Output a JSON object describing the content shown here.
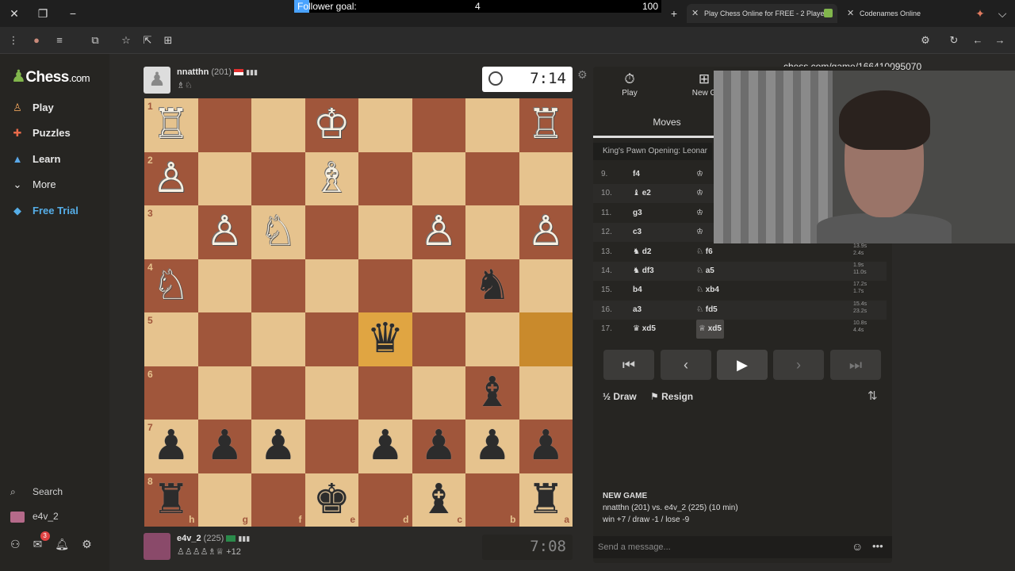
{
  "browser": {
    "follower_goal": {
      "label": "Follower goal:",
      "current": "4",
      "target": "100",
      "progress": 0.04
    },
    "tabs": [
      {
        "title": "Play Chess Online for FREE - 2 Player",
        "active": true
      },
      {
        "title": "Codenames Online",
        "active": false
      }
    ],
    "url": "chess.com/game/166410095070"
  },
  "sidebar": {
    "logo_text": "Chess",
    "logo_suffix": ".com",
    "nav": [
      {
        "label": "Play",
        "icon": "play-hand-icon"
      },
      {
        "label": "Puzzles",
        "icon": "puzzle-icon"
      },
      {
        "label": "Learn",
        "icon": "learn-cap-icon"
      },
      {
        "label": "More",
        "icon": "chevron-down-icon"
      },
      {
        "label": "Free Trial",
        "icon": "diamond-icon"
      }
    ],
    "search_label": "Search",
    "username": "e4v_2",
    "notification_count": "3"
  },
  "game": {
    "top_player": {
      "name": "nnatthn",
      "rating": "(201)",
      "clock": "7:14"
    },
    "bottom_player": {
      "name": "e4v_2",
      "rating": "(225)",
      "captured_advantage": "+12",
      "clock": "7:08"
    },
    "files": [
      "h",
      "g",
      "f",
      "e",
      "d",
      "c",
      "b",
      "a"
    ],
    "ranks": [
      "1",
      "2",
      "3",
      "4",
      "5",
      "6",
      "7",
      "8"
    ],
    "board": [
      [
        "wR",
        "",
        "",
        "wK",
        "",
        "",
        "",
        "wR"
      ],
      [
        "wP",
        "",
        "",
        "wB",
        "",
        "",
        "",
        ""
      ],
      [
        "",
        "wP",
        "wN",
        "",
        "",
        "wP",
        "",
        "wP"
      ],
      [
        "wN",
        "",
        "",
        "",
        "",
        "",
        "bN",
        ""
      ],
      [
        "",
        "",
        "",
        "",
        "bQ",
        "",
        "",
        ""
      ],
      [
        "",
        "",
        "",
        "",
        "",
        "",
        "bB",
        ""
      ],
      [
        "bP",
        "bP",
        "bP",
        "",
        "bP",
        "bP",
        "bP",
        "bP"
      ],
      [
        "bR",
        "",
        "",
        "bK",
        "",
        "bB",
        "",
        "bR"
      ]
    ],
    "highlight": [
      [
        4,
        4
      ],
      [
        4,
        7
      ]
    ]
  },
  "panel": {
    "tab_play": "Play",
    "tab_new": "New G",
    "moves_tab": "Moves",
    "opening": "King's Pawn Opening: Leonar",
    "moves": [
      {
        "n": "9.",
        "w": "f4",
        "b": "♔",
        "tw": "",
        "tb": ""
      },
      {
        "n": "10.",
        "w": "♝ e2",
        "b": "♔",
        "tw": "",
        "tb": ""
      },
      {
        "n": "11.",
        "w": "g3",
        "b": "♔",
        "tw": "",
        "tb": ""
      },
      {
        "n": "12.",
        "w": "c3",
        "b": "♔",
        "tw": "",
        "tb": ""
      },
      {
        "n": "13.",
        "w": "♞ d2",
        "b": "♘ f6",
        "tw": "13.9s",
        "tb": "2.4s"
      },
      {
        "n": "14.",
        "w": "♞ df3",
        "b": "♘ a5",
        "tw": "1.9s",
        "tb": "11.0s"
      },
      {
        "n": "15.",
        "w": "b4",
        "b": "♘ xb4",
        "tw": "17.2s",
        "tb": "1.7s"
      },
      {
        "n": "16.",
        "w": "a3",
        "b": "♘ fd5",
        "tw": "15.4s",
        "tb": "23.2s"
      },
      {
        "n": "17.",
        "w": "♛ xd5",
        "b": "♕ xd5",
        "tw": "10.8s",
        "tb": "4.4s"
      }
    ],
    "draw_label": "Draw",
    "resign_label": "Resign",
    "new_game": {
      "title": "NEW GAME",
      "line1": "nnatthn (201) vs. e4v_2 (225) (10 min)",
      "line2": "win +7 / draw -1 / lose -9"
    },
    "message_placeholder": "Send a message..."
  }
}
